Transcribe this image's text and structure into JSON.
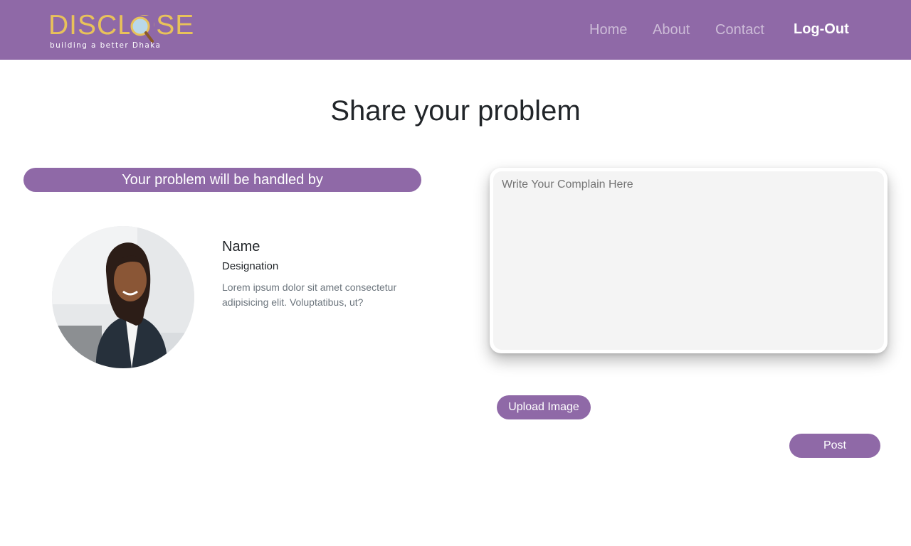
{
  "navbar": {
    "logo": {
      "text": "DISCLOSE",
      "tagline": "building a better Dhaka",
      "icon": "magnifier-icon"
    },
    "links": {
      "home": "Home",
      "about": "About",
      "contact": "Contact"
    },
    "logout_label": "Log-Out"
  },
  "main": {
    "title": "Share your problem",
    "handler": {
      "banner": "Your problem will be handled by",
      "name": "Name",
      "designation": "Designation",
      "description": "Lorem ipsum dolor sit amet consectetur adipisicing elit. Voluptatibus, ut?"
    },
    "complaint": {
      "placeholder": "Write Your Complain Here",
      "value": ""
    },
    "upload_label": "Upload Image",
    "post_label": "Post"
  },
  "colors": {
    "brand": "#8f69a7",
    "logo_gold": "#e8c25a",
    "textarea_bg": "#f4f4f4"
  }
}
